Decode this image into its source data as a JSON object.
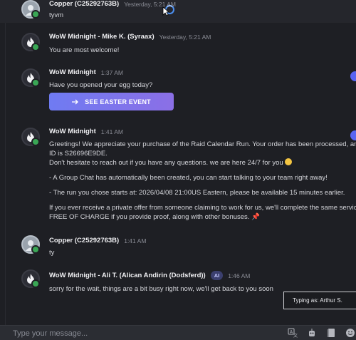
{
  "messages": [
    {
      "author": "Copper (C25292763B)",
      "time": "Yesterday, 5:21 AM",
      "lines": [
        "tyvm"
      ]
    },
    {
      "author": "WoW Midnight - Mike K. (Syraax)",
      "time": "Yesterday, 5:21 AM",
      "lines": [
        "You are most welcome!"
      ]
    },
    {
      "author": "WoW Midnight",
      "time": "1:37 AM",
      "lines": [
        "Have you opened your egg today?"
      ],
      "button": "SEE EASTER EVENT"
    },
    {
      "author": "WoW Midnight",
      "time": "1:41 AM",
      "lines": [
        "Greetings! We appreciate your purchase of the Raid Calendar Run. Your order has been processed, and yo",
        "ID is S26696E9DE.",
        "Don't hesitate to reach out if you have any questions. we are here 24/7 for you",
        "- A Group Chat has automatically been created, you can start talking to your team right away!",
        "- The run you chose starts at: 2026/04/08 21:00US Eastern, please be available 15 minutes earlier.",
        "If you ever receive a private offer from someone claiming to work for us, we'll complete the same service f",
        "FREE OF CHARGE if you provide proof, along with other bonuses."
      ]
    },
    {
      "author": "Copper (C25292763B)",
      "time": "1:41 AM",
      "lines": [
        "ty"
      ]
    },
    {
      "author": "WoW Midnight - Ali T. (Alican Andirin (Dodsferd))",
      "badge": "AI",
      "time": "1:46 AM",
      "lines": [
        "sorry for the wait, things are a bit busy right now, we'll get back to you soon"
      ]
    }
  ],
  "typing": "Typing as: Arthur S.",
  "composer": {
    "placeholder": "Type your message..."
  },
  "icons": [
    "translate-icon",
    "bot-icon",
    "book-icon",
    "emoji-icon"
  ],
  "colors": {
    "accent": "#6f7bf2",
    "online": "#3aa655",
    "background": "#1e1f24"
  }
}
